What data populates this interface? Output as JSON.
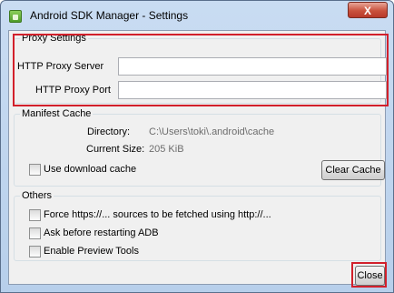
{
  "window": {
    "title": "Android SDK Manager - Settings",
    "close_glyph": "X"
  },
  "proxy": {
    "group_title": "Proxy Settings",
    "server_label": "HTTP Proxy Server",
    "server_value": "",
    "port_label": "HTTP Proxy Port",
    "port_value": ""
  },
  "manifest": {
    "group_title": "Manifest Cache",
    "directory_label": "Directory:",
    "directory_value": "C:\\Users\\toki\\.android\\cache",
    "size_label": "Current Size:",
    "size_value": "205 KiB",
    "use_cache_label": "Use download cache",
    "use_cache_checked": false,
    "clear_cache_label": "Clear Cache"
  },
  "others": {
    "group_title": "Others",
    "options": [
      {
        "label": "Force https://... sources to be fetched using http://...",
        "checked": false
      },
      {
        "label": "Ask before restarting ADB",
        "checked": false
      },
      {
        "label": "Enable Preview Tools",
        "checked": false
      }
    ]
  },
  "footer": {
    "close_label": "Close"
  },
  "colors": {
    "highlight": "#d2202b",
    "dialog_bg": "#f0f0f0",
    "title_bar": "#c9dcf2"
  }
}
